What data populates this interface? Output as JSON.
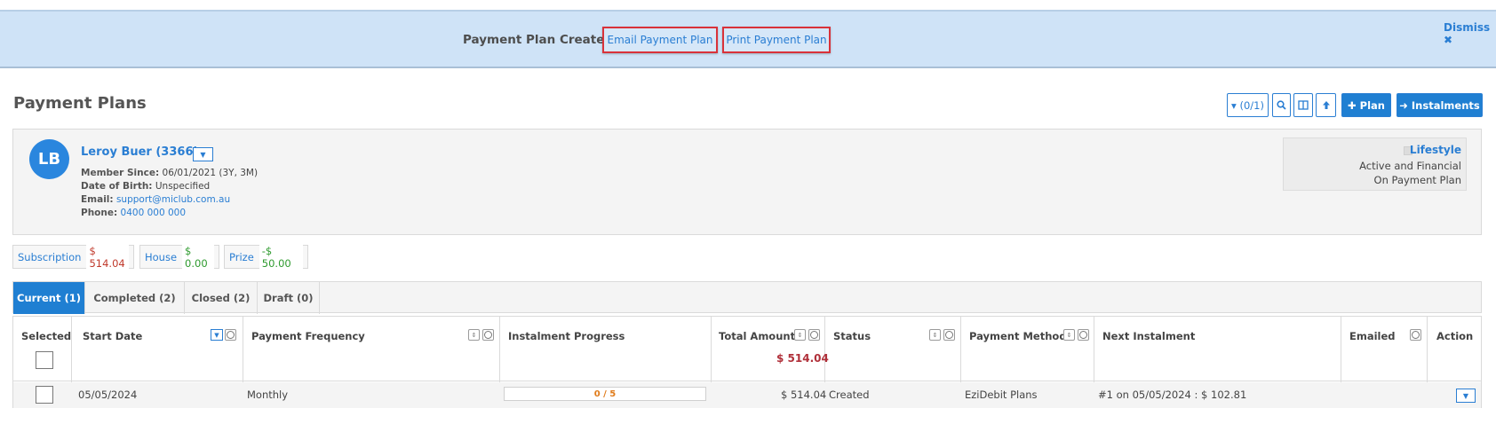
{
  "banner": {
    "message": "Payment Plan Created:",
    "email_link": "Email Payment Plan",
    "print_link": "Print Payment Plan",
    "dismiss": "Dismiss ✖"
  },
  "page": {
    "title": "Payment Plans",
    "toolbar": {
      "filter_count": "▾ (0/1)",
      "search_icon": "search-icon",
      "columns_icon": "columns-icon",
      "export_icon": "arrow-up-icon",
      "plan_button": "✚ Plan",
      "instalments_button": "➜ Instalments"
    }
  },
  "member": {
    "initials": "LB",
    "name": "Leroy Buer (3366)",
    "member_since_label": "Member Since:",
    "member_since_value": "06/01/2021 (3Y, 3M)",
    "dob_label": "Date of Birth:",
    "dob_value": "Unspecified",
    "email_label": "Email:",
    "email_value": "support@miclub.com.au",
    "phone_label": "Phone:",
    "phone_value": "0400 000 000",
    "membership": {
      "title": "Lifestyle",
      "status1": "Active and Financial",
      "status2": "On Payment Plan"
    }
  },
  "summary": {
    "subscription_label": "Subscription",
    "subscription_value": "$ 514.04",
    "house_label": "House",
    "house_value": "$ 0.00",
    "prize_label": "Prize",
    "prize_value": "-$ 50.00"
  },
  "tabs": [
    {
      "label": "Current (1)",
      "active": true
    },
    {
      "label": "Completed (2)",
      "active": false
    },
    {
      "label": "Closed (2)",
      "active": false
    },
    {
      "label": "Draft (0)",
      "active": false
    }
  ],
  "table": {
    "headers": {
      "selected": "Selected",
      "start_date": "Start Date",
      "frequency": "Payment Frequency",
      "progress": "Instalment Progress",
      "total": "Total Amount",
      "status": "Status",
      "method": "Payment Method",
      "next": "Next Instalment",
      "emailed": "Emailed",
      "action": "Action"
    },
    "total_sum": "$ 514.04",
    "rows": [
      {
        "start_date": "05/05/2024",
        "frequency": "Monthly",
        "progress": "0 / 5",
        "total": "$ 514.04",
        "status": "Created",
        "method": "EziDebit Plans",
        "next": "#1 on 05/05/2024 : $ 102.81",
        "emailed": ""
      }
    ]
  }
}
